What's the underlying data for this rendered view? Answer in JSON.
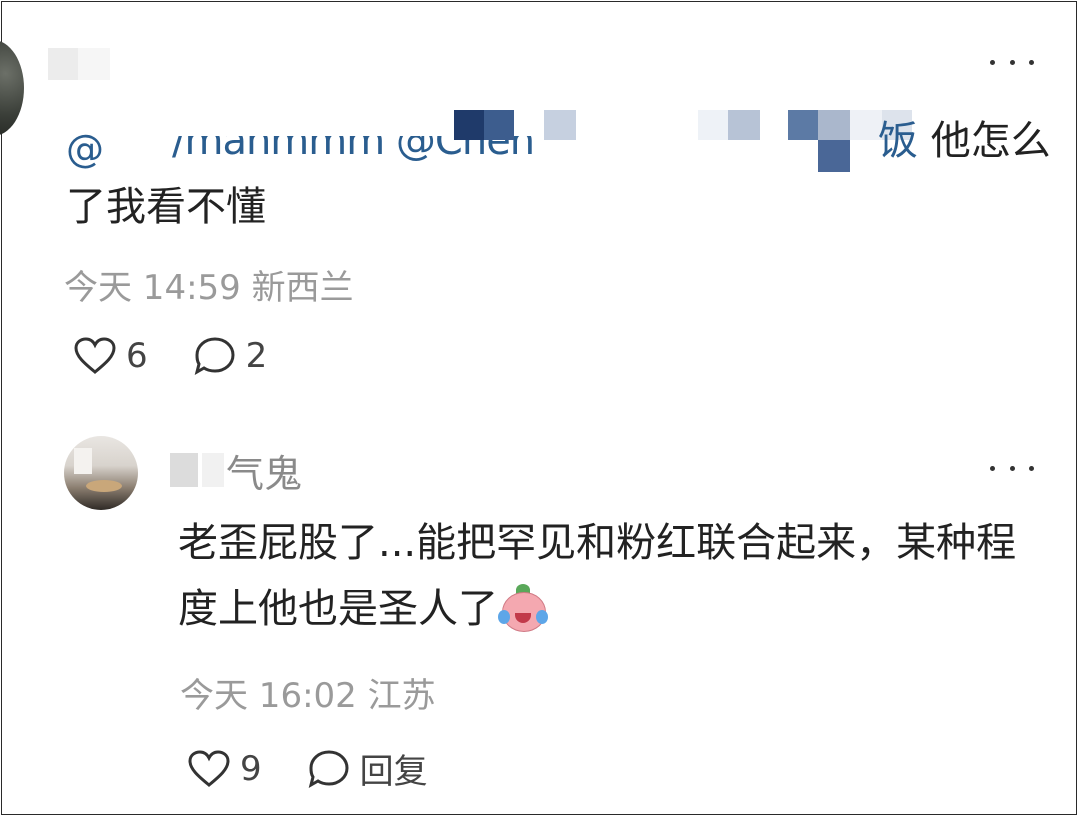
{
  "comment1": {
    "mention_visible_text": "/manmmm @Chen",
    "body_tail_blue": "饭",
    "body_tail": " 他怎么",
    "body_line2": "了我看不懂",
    "meta": "今天 14:59 新西兰",
    "likes": "6",
    "replies": "2"
  },
  "comment2": {
    "author_suffix": "气鬼",
    "body": "老歪屁股了...能把罕见和粉红联合起来，某种程度上他也是圣人了",
    "meta": "今天 16:02 江苏",
    "likes": "9",
    "reply_label": "回复"
  },
  "icons": {
    "more": "more-icon",
    "like": "heart-icon",
    "comment": "comment-bubble-icon",
    "mention": "at-icon",
    "emoji": "crying-emoji-icon"
  },
  "colors": {
    "link": "#2a5d8f",
    "meta": "#9a9a9a",
    "text": "#222222"
  }
}
